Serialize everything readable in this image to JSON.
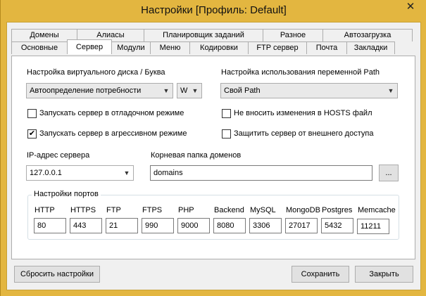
{
  "window": {
    "title": "Настройки [Профиль: Default]",
    "close_glyph": "✕"
  },
  "tabs_back": [
    "Домены",
    "Алиасы",
    "Планировщик заданий",
    "Разное",
    "Автозагрузка"
  ],
  "tabs_front": [
    "Основные",
    "Сервер",
    "Модули",
    "Меню",
    "Кодировки",
    "FTP сервер",
    "Почта",
    "Закладки"
  ],
  "active_tab": "Сервер",
  "server": {
    "disk_label": "Настройка виртуального диска / Буква",
    "disk_value": "Автоопределение потребности",
    "letter_value": "W",
    "path_label": "Настройка использования переменной Path",
    "path_value": "Свой Path",
    "checkboxes": [
      {
        "label": "Запускать сервер в отладочном режиме",
        "checked": false
      },
      {
        "label": "Не вносить изменения в HOSTS файл",
        "checked": false
      },
      {
        "label": "Запускать сервер в агрессивном режиме",
        "checked": true
      },
      {
        "label": "Защитить сервер от внешнего доступа",
        "checked": false
      }
    ],
    "ip_label": "IP-адрес сервера",
    "ip_value": "127.0.0.1",
    "domains_label": "Корневая папка доменов",
    "domains_value": "domains",
    "browse_label": "..."
  },
  "ports": {
    "title": "Настройки портов",
    "items": [
      {
        "name": "HTTP",
        "value": "80"
      },
      {
        "name": "HTTPS",
        "value": "443"
      },
      {
        "name": "FTP",
        "value": "21"
      },
      {
        "name": "FTPS",
        "value": "990"
      },
      {
        "name": "PHP",
        "value": "9000"
      },
      {
        "name": "Backend",
        "value": "8080"
      },
      {
        "name": "MySQL",
        "value": "3306"
      },
      {
        "name": "MongoDB",
        "value": "27017"
      },
      {
        "name": "Postgres",
        "value": "5432"
      },
      {
        "name": "Memcache",
        "value": "11211"
      }
    ]
  },
  "buttons": {
    "reset": "Сбросить настройки",
    "save": "Сохранить",
    "close": "Закрыть"
  },
  "colors": {
    "titlebar": "#e3b640",
    "dialog": "#f0f0f0",
    "panel": "#ffffff"
  }
}
